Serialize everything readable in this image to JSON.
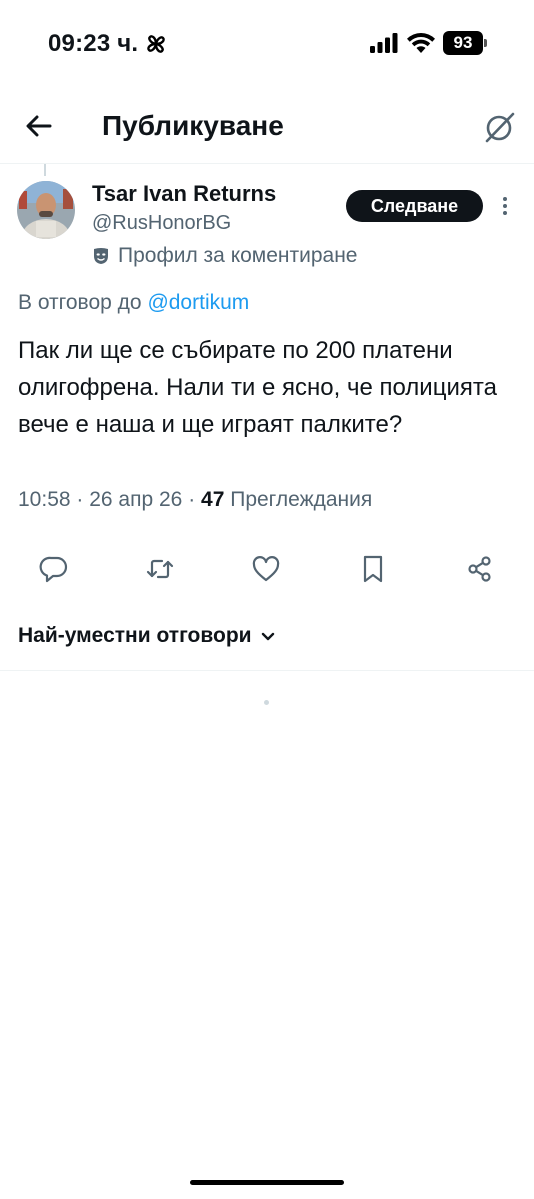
{
  "status_bar": {
    "time": "09:23 ч.",
    "battery": "93"
  },
  "header": {
    "title": "Публикуване"
  },
  "tweet": {
    "author_name": "Tsar Ivan Returns",
    "author_handle": "@RusHonorBG",
    "profile_label": "Профил за коментиране",
    "follow_label": "Следване",
    "reply_prefix": "В отговор до ",
    "reply_mention": "@dortikum",
    "text": "Пак ли ще се събирате по 200 платени олигофрена. Нали ти е ясно, че полицията вече е наша и ще играят палките?",
    "time": "10:58",
    "date": "26 апр 26",
    "view_count": "47",
    "views_label": "Преглеждания",
    "separator": " · "
  },
  "replies": {
    "sort_label": "Най-уместни отговори"
  },
  "colors": {
    "accent": "#1d9bf0",
    "text": "#0f1419",
    "secondary": "#536471",
    "border": "#eff3f4"
  }
}
